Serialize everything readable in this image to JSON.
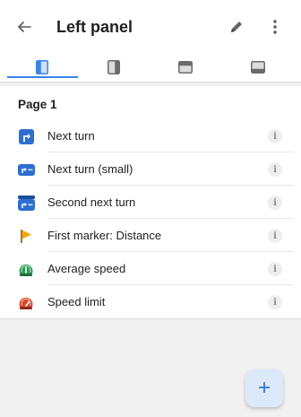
{
  "header": {
    "title": "Left panel",
    "back_icon": "arrow-back-icon",
    "edit_icon": "pencil-icon",
    "more_icon": "more-vert-icon"
  },
  "tabs": [
    {
      "icon": "left-panel-icon",
      "selected": true
    },
    {
      "icon": "right-panel-icon",
      "selected": false
    },
    {
      "icon": "top-panel-icon",
      "selected": false
    },
    {
      "icon": "bottom-panel-icon",
      "selected": false
    }
  ],
  "section": {
    "title": "Page 1"
  },
  "widgets": [
    {
      "label": "Next turn",
      "icon": "next-turn-icon"
    },
    {
      "label": "Next turn (small)",
      "icon": "next-turn-small-icon"
    },
    {
      "label": "Second next turn",
      "icon": "second-next-turn-icon"
    },
    {
      "label": "First marker: Distance",
      "icon": "marker-flag-icon"
    },
    {
      "label": "Average speed",
      "icon": "average-speed-icon"
    },
    {
      "label": "Speed limit",
      "icon": "speed-limit-icon"
    }
  ],
  "info_glyph": "i",
  "fab": {
    "label": "+",
    "icon": "add-icon"
  },
  "colors": {
    "accent": "#3a84e6",
    "tab_icon_active": "#3a84e6",
    "tab_icon_inactive": "#6b6b6b",
    "marker_flag": "#f2a60c",
    "speed_green": "#2e9d57",
    "speed_red": "#d9472b"
  }
}
